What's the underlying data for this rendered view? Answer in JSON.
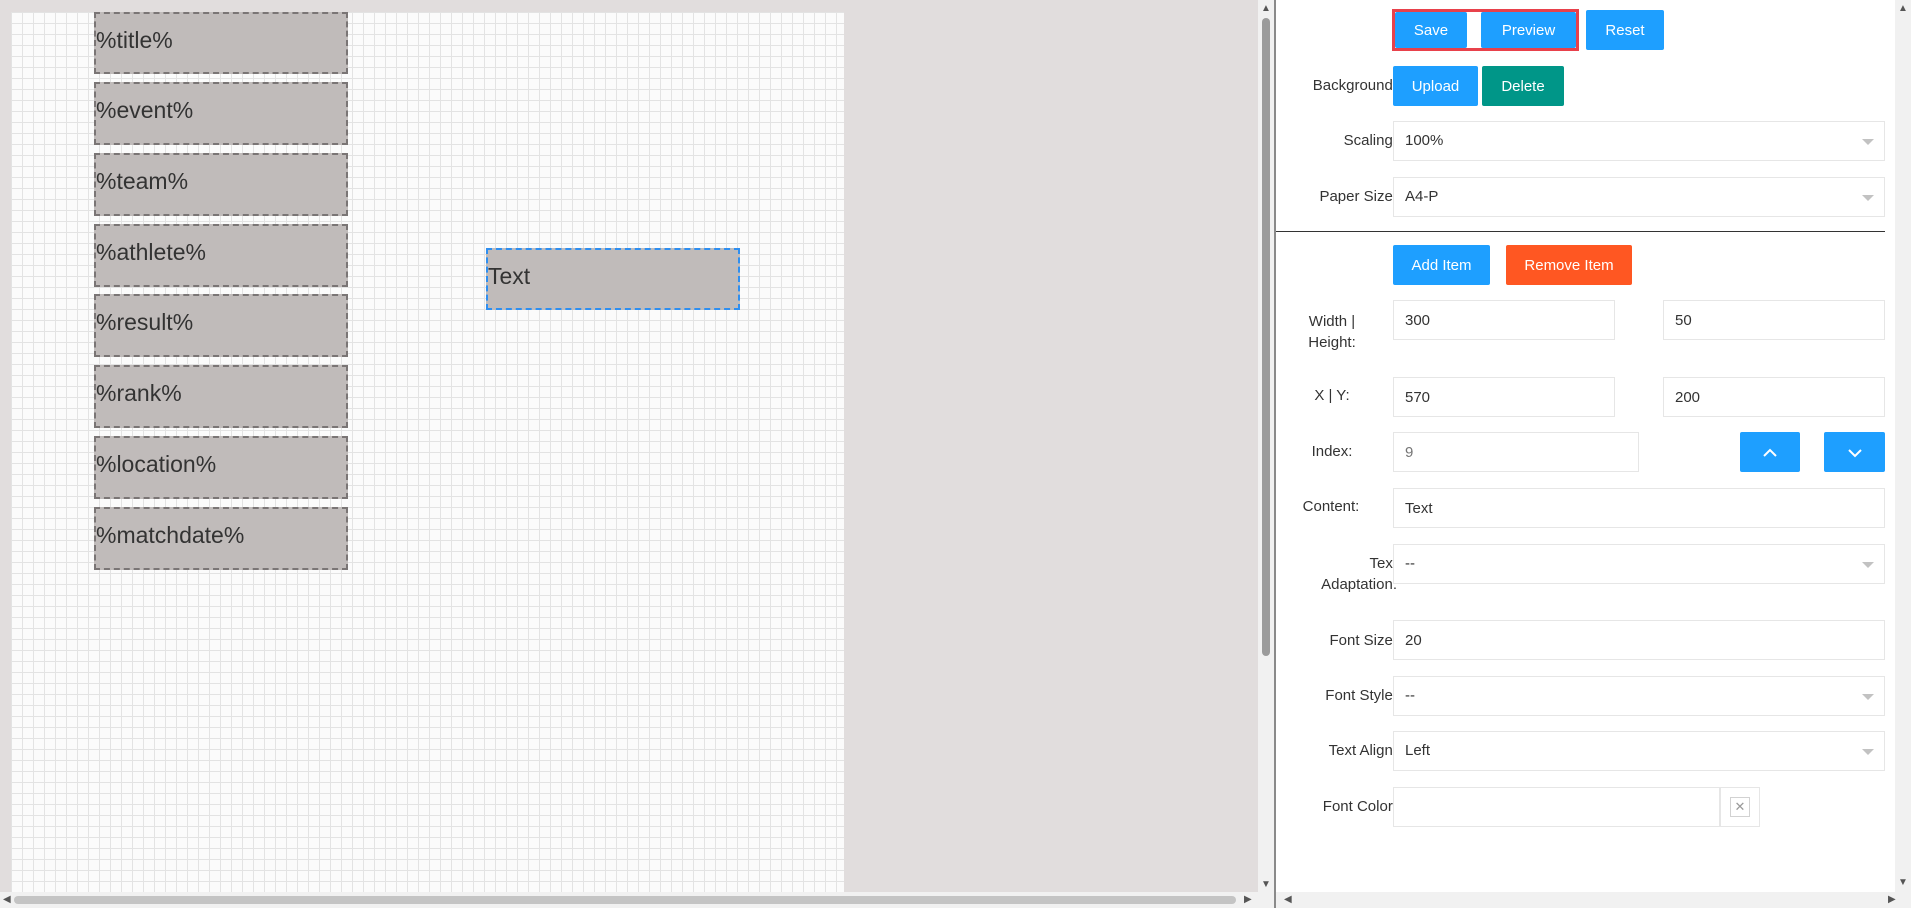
{
  "canvas": {
    "items": [
      {
        "text": "%title%"
      },
      {
        "text": "%event%"
      },
      {
        "text": "%team%"
      },
      {
        "text": "%athlete%"
      },
      {
        "text": "%result%"
      },
      {
        "text": "%rank%"
      },
      {
        "text": "%location%"
      },
      {
        "text": "%matchdate%"
      }
    ],
    "selected_item": {
      "text": "Text"
    }
  },
  "toolbar": {
    "save_label": "Save",
    "preview_label": "Preview",
    "reset_label": "Reset"
  },
  "background": {
    "label": "Background:",
    "upload_label": "Upload",
    "delete_label": "Delete"
  },
  "scaling": {
    "label": "Scaling:",
    "value": "100%"
  },
  "paper_size": {
    "label": "Paper Size:",
    "value": "A4-P"
  },
  "items": {
    "add_label": "Add Item",
    "remove_label": "Remove Item"
  },
  "properties": {
    "width_height_label_1": "Width |",
    "width_height_label_2": "Height:",
    "width": "300",
    "height": "50",
    "xy_label": "X | Y:",
    "x": "570",
    "y": "200",
    "index_label": "Index:",
    "index_placeholder": "9",
    "content_label": "Content:",
    "content": "Text",
    "text_adaptation_label_1": "Text",
    "text_adaptation_label_2": "Adaptation:",
    "text_adaptation": "--",
    "font_size_label": "Font Size:",
    "font_size": "20",
    "font_style_label": "Font Style:",
    "font_style": "--",
    "text_align_label": "Text Align:",
    "text_align": "Left",
    "font_color_label": "Font Color:",
    "font_color": ""
  },
  "colors": {
    "primary": "#1e9fff",
    "teal": "#009688",
    "orange": "#ff5722",
    "highlight": "#e8414b"
  }
}
